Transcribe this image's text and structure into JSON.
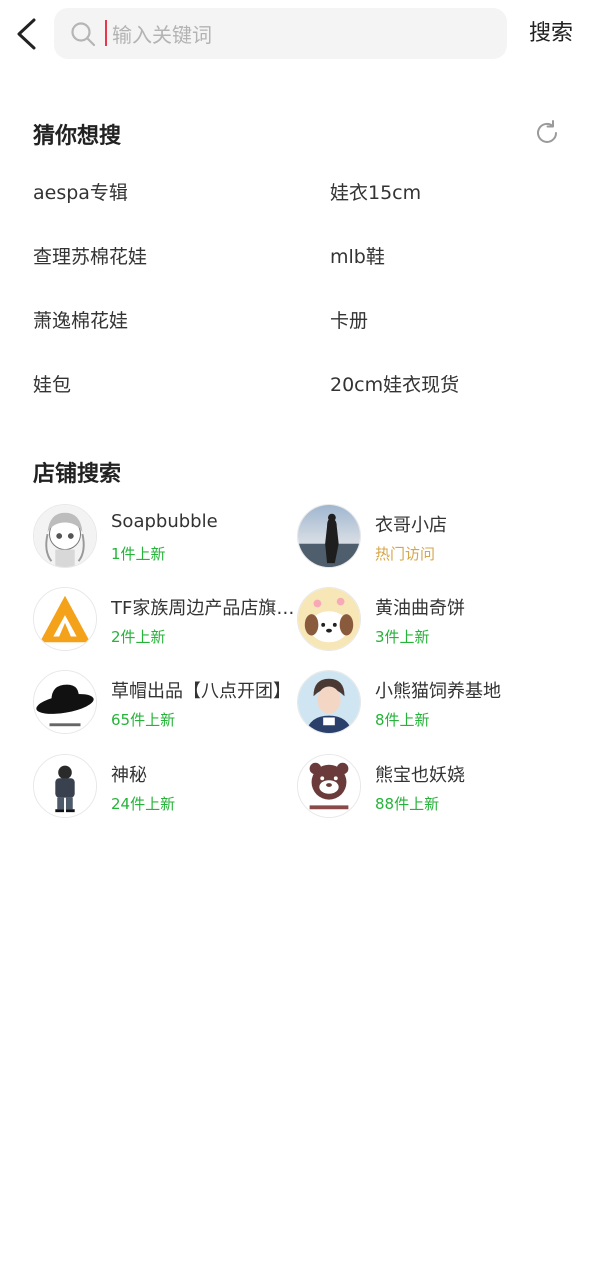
{
  "search": {
    "placeholder": "输入关键词",
    "button_label": "搜索"
  },
  "suggestions": {
    "title": "猜你想搜",
    "items": [
      "aespa专辑",
      "娃衣15cm",
      "查理苏棉花娃",
      "mlb鞋",
      "萧逸棉花娃",
      "卡册",
      "娃包",
      "20cm娃衣现货"
    ]
  },
  "shops": {
    "title": "店铺搜索",
    "items": [
      {
        "name": "Soapbubble",
        "sub": "1件上新",
        "sub_type": "new"
      },
      {
        "name": "衣哥小店",
        "sub": "热门访问",
        "sub_type": "hot"
      },
      {
        "name": "TF家族周边产品店旗舰店",
        "sub": "2件上新",
        "sub_type": "new"
      },
      {
        "name": "黄油曲奇饼",
        "sub": "3件上新",
        "sub_type": "new"
      },
      {
        "name": "草帽出品【八点开团】",
        "sub": "65件上新",
        "sub_type": "new"
      },
      {
        "name": "小熊猫饲养基地",
        "sub": "8件上新",
        "sub_type": "new"
      },
      {
        "name": "神秘",
        "sub": "24件上新",
        "sub_type": "new"
      },
      {
        "name": "熊宝也妖娆",
        "sub": "88件上新",
        "sub_type": "new"
      }
    ]
  },
  "colors": {
    "accent_new": "#26b33a",
    "accent_hot": "#d6a64a",
    "caret": "#e8364a"
  },
  "icons": [
    "back-arrow-icon",
    "search-icon",
    "refresh-icon"
  ]
}
